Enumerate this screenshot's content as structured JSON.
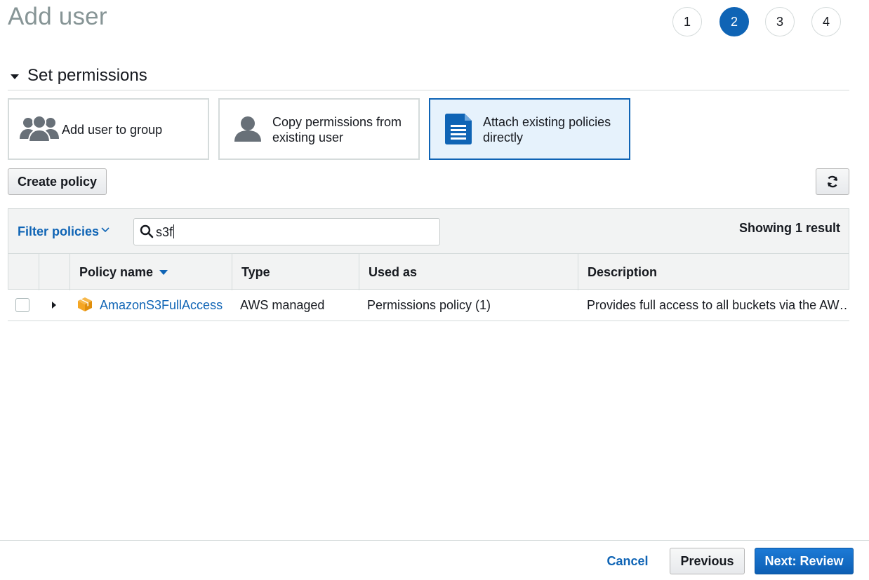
{
  "page": {
    "title": "Add user"
  },
  "steps": [
    {
      "label": "1",
      "active": false
    },
    {
      "label": "2",
      "active": true
    },
    {
      "label": "3",
      "active": false
    },
    {
      "label": "4",
      "active": false
    }
  ],
  "section": {
    "title": "Set permissions"
  },
  "options": [
    {
      "label": "Add user to group",
      "icon": "users-group-icon",
      "selected": false
    },
    {
      "label_line1": "Copy permissions from",
      "label_line2": "existing user",
      "icon": "user-icon",
      "selected": false
    },
    {
      "label_line1": "Attach existing policies",
      "label_line2": "directly",
      "icon": "document-icon",
      "selected": true
    }
  ],
  "toolbar": {
    "create_policy": "Create policy",
    "refresh_icon": "refresh-icon"
  },
  "filter": {
    "label": "Filter policies",
    "search_value": "s3f",
    "result_count": "Showing 1 result"
  },
  "table": {
    "columns": [
      "Policy name",
      "Type",
      "Used as",
      "Description"
    ],
    "rows": [
      {
        "name": "AmazonS3FullAccess",
        "type": "AWS managed",
        "used_as": "Permissions policy (1)",
        "description": "Provides full access to all buckets via the AW…"
      }
    ]
  },
  "footer": {
    "cancel": "Cancel",
    "previous": "Previous",
    "next": "Next: Review"
  },
  "colors": {
    "accent": "#0f64b5",
    "aws_orange": "#f5a623",
    "muted_title": "#879596"
  }
}
